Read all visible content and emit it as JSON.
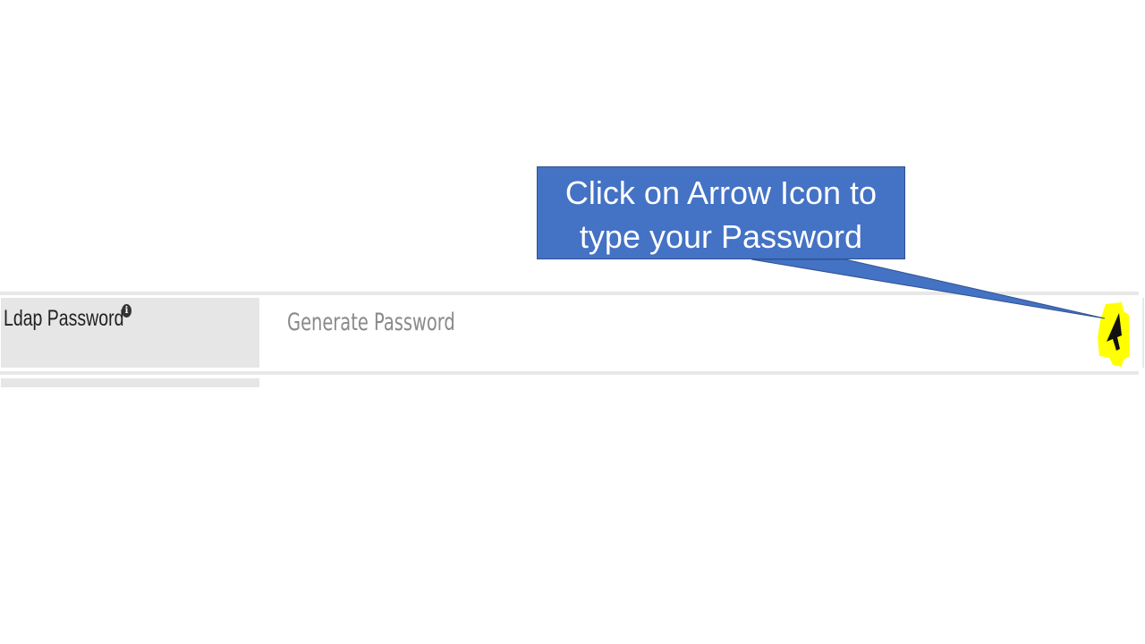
{
  "field": {
    "label": "Ldap Password",
    "info_icon": "info-icon",
    "info_glyph": "i",
    "placeholder": "Generate Password",
    "action_icon": "arrow-cursor-icon",
    "highlight_color": "#ffff00"
  },
  "callout": {
    "text": "Click on Arrow Icon to type your Password",
    "line1": "Click on Arrow Icon to",
    "line2": "type your Password",
    "color": "#4472c4"
  }
}
